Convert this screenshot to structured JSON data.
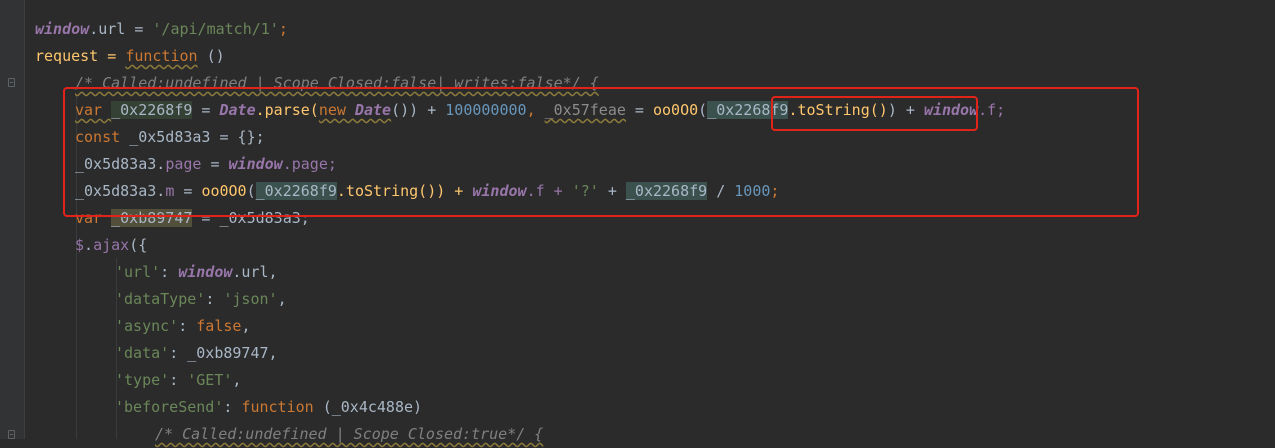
{
  "editor": {
    "lines": [
      [
        "window",
        ".url = ",
        "'/api/match/1'",
        ";"
      ],
      [
        "request = ",
        "function",
        " ()"
      ],
      [
        "/* Called:undefined | Scope Closed:false| writes:false*/ {"
      ],
      [
        "var ",
        "_0x2268f9",
        " = ",
        "Date",
        ".parse(",
        "new ",
        "Date",
        "()) + ",
        "100000000",
        ", ",
        "_0x57feae",
        " = ",
        "oo0O0",
        "(",
        "_0x2268f9",
        ".toString()",
        ") + ",
        "window",
        ".f;"
      ],
      [
        "const ",
        "_0x5d83a3 = {};"
      ],
      [
        "_0x5d83a3.",
        "page",
        " = ",
        "window",
        ".page;"
      ],
      [
        "_0x5d83a3.",
        "m",
        " = ",
        "oo0O0",
        "(",
        "_0x2268f9",
        ".toString()) + ",
        "window",
        ".f + ",
        "'?'",
        " + ",
        "_0x2268f9",
        " / ",
        "1000",
        ";"
      ],
      [
        "var ",
        "_0xb89747",
        " = _0x5d83a3;"
      ],
      [
        "$",
        ".",
        "ajax",
        "({"
      ],
      [
        "'url'",
        ": ",
        "window",
        ".url,"
      ],
      [
        "'dataType'",
        ": ",
        "'json'",
        ","
      ],
      [
        "'async'",
        ": ",
        "false",
        ","
      ],
      [
        "'data'",
        ": _0xb89747,"
      ],
      [
        "'type'",
        ": ",
        "'GET'",
        ","
      ],
      [
        "'beforeSend'",
        ": ",
        "function",
        " (_0x4c488e)"
      ],
      [
        "/* Called:undefined | Scope Closed:true*/ {"
      ]
    ]
  }
}
